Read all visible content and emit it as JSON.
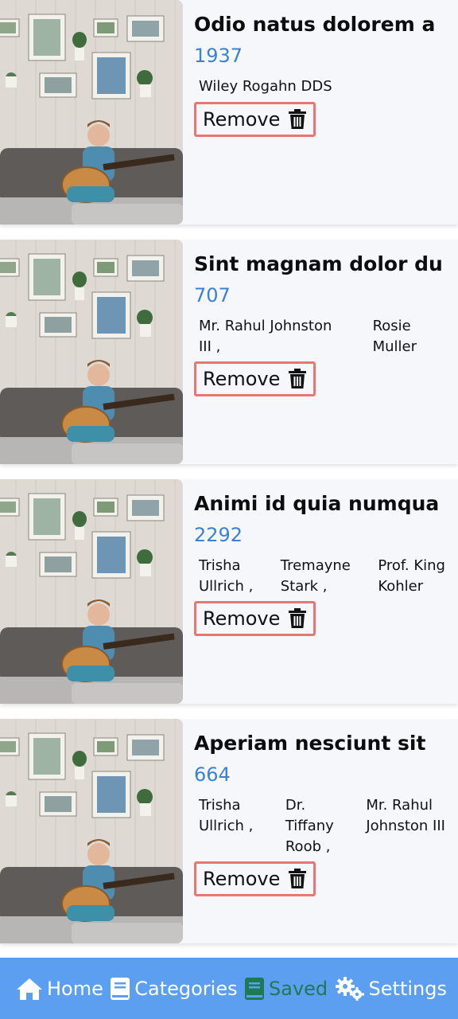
{
  "items": [
    {
      "title": "Odio natus dolorem a",
      "year": "1937",
      "authors": [
        "Wiley Rogahn DDS"
      ],
      "remove_label": "Remove"
    },
    {
      "title": "Sint magnam dolor du",
      "year": "707",
      "authors": [
        "Mr. Rahul Johnston\nIII ,",
        "Rosie\nMuller"
      ],
      "remove_label": "Remove"
    },
    {
      "title": "Animi id quia numqua",
      "year": "2292",
      "authors": [
        "Trisha\nUllrich ,",
        "Tremayne\nStark ,",
        "Prof. King\nKohler"
      ],
      "remove_label": "Remove"
    },
    {
      "title": "Aperiam nesciunt sit",
      "year": "664",
      "authors": [
        "Trisha\nUllrich ,",
        "Dr.\nTiffany\nRoob ,",
        "Mr. Rahul\nJohnston III"
      ],
      "remove_label": "Remove"
    }
  ],
  "nav": {
    "home": "Home",
    "categories": "Categories",
    "saved": "Saved",
    "settings": "Settings",
    "active_tab": "saved"
  },
  "colors": {
    "accent": "#5c9ff0",
    "year": "#3b82d6",
    "remove_border": "#e87673",
    "active_tab": "#1d7a52"
  },
  "icons": {
    "remove": "trash-icon",
    "home": "home-icon",
    "categories": "book-icon",
    "saved": "bookmark-book-icon",
    "settings": "gears-icon"
  }
}
